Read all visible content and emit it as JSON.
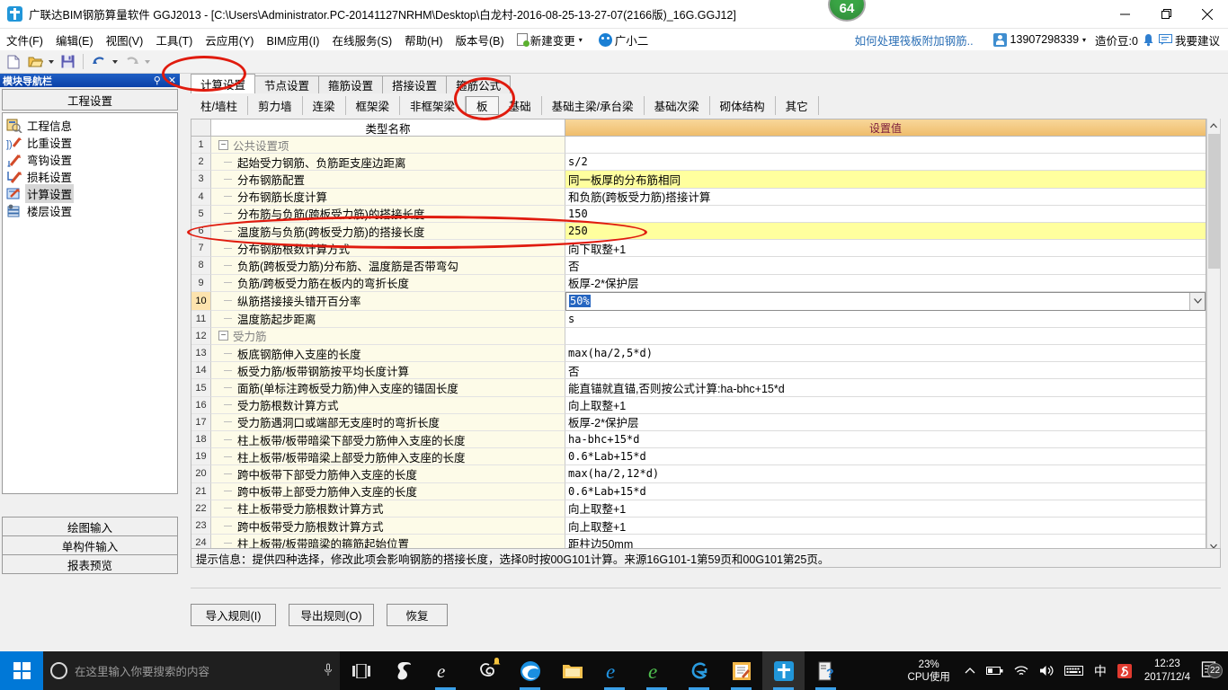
{
  "window": {
    "title": "广联达BIM钢筋算量软件 GGJ2013 - [C:\\Users\\Administrator.PC-20141127NRHM\\Desktop\\白龙村-2016-08-25-13-27-07(2166版)_16G.GGJ12]",
    "badge": "64",
    "minimize": "–",
    "maximize": "❐",
    "close": "✕"
  },
  "menu": {
    "items": [
      "文件(F)",
      "编辑(E)",
      "视图(V)",
      "工具(T)",
      "云应用(Y)",
      "BIM应用(I)",
      "在线服务(S)",
      "帮助(H)",
      "版本号(B)"
    ],
    "new_change": "新建变更",
    "assistant": "广小二",
    "help_link": "如何处理筏板附加钢筋..",
    "account": "13907298339",
    "coins": "造价豆:0",
    "feedback": "我要建议"
  },
  "left_panel": {
    "title": "模块导航栏",
    "pin": "⚲",
    "close": "✕",
    "group_title": "工程设置",
    "items": [
      {
        "label": "工程信息",
        "icon": "project-info-icon"
      },
      {
        "label": "比重设置",
        "icon": "weight-settings-icon"
      },
      {
        "label": "弯钩设置",
        "icon": "hook-settings-icon"
      },
      {
        "label": "损耗设置",
        "icon": "loss-settings-icon"
      },
      {
        "label": "计算设置",
        "icon": "calc-settings-icon"
      },
      {
        "label": "楼层设置",
        "icon": "floor-settings-icon"
      }
    ],
    "selected_index": 4,
    "bottom_buttons": [
      "绘图输入",
      "单构件输入",
      "报表预览"
    ]
  },
  "tabs_primary": {
    "items": [
      "计算设置",
      "节点设置",
      "箍筋设置",
      "搭接设置",
      "箍筋公式"
    ],
    "active_index": 0
  },
  "tabs_secondary": {
    "items": [
      "柱/墙柱",
      "剪力墙",
      "连梁",
      "框架梁",
      "非框架梁",
      "板",
      "基础",
      "基础主梁/承台梁",
      "基础次梁",
      "砌体结构",
      "其它"
    ],
    "active_index": 5
  },
  "grid": {
    "header": {
      "num": "",
      "name": "类型名称",
      "value": "设置值"
    },
    "rows": [
      {
        "n": "1",
        "kind": "group",
        "name": "公共设置项",
        "value": "",
        "vhl": false
      },
      {
        "n": "2",
        "kind": "item",
        "name": "起始受力钢筋、负筋距支座边距离",
        "value": "s/2",
        "vhl": false
      },
      {
        "n": "3",
        "kind": "item",
        "name": "分布钢筋配置",
        "value": "同一板厚的分布筋相同",
        "vhl": true,
        "cn": true
      },
      {
        "n": "4",
        "kind": "item",
        "name": "分布钢筋长度计算",
        "value": "和负筋(跨板受力筋)搭接计算",
        "vhl": false,
        "cn": true
      },
      {
        "n": "5",
        "kind": "item",
        "name": "分布筋与负筋(跨板受力筋)的搭接长度",
        "value": "150",
        "vhl": false
      },
      {
        "n": "6",
        "kind": "item",
        "name": "温度筋与负筋(跨板受力筋)的搭接长度",
        "value": "250",
        "vhl": true
      },
      {
        "n": "7",
        "kind": "item",
        "name": "分布钢筋根数计算方式",
        "value": "向下取整+1",
        "vhl": false,
        "cn": true
      },
      {
        "n": "8",
        "kind": "item",
        "name": "负筋(跨板受力筋)分布筋、温度筋是否带弯勾",
        "value": "否",
        "vhl": false,
        "cn": true
      },
      {
        "n": "9",
        "kind": "item",
        "name": "负筋/跨板受力筋在板内的弯折长度",
        "value": "板厚-2*保护层",
        "vhl": false,
        "cn": true
      },
      {
        "n": "10",
        "kind": "editor",
        "name": "纵筋搭接接头错开百分率",
        "value": "50%",
        "vhl": false
      },
      {
        "n": "11",
        "kind": "item",
        "name": "温度筋起步距离",
        "value": "s",
        "vhl": false
      },
      {
        "n": "12",
        "kind": "group",
        "name": "受力筋",
        "value": "",
        "vhl": false
      },
      {
        "n": "13",
        "kind": "item",
        "name": "板底钢筋伸入支座的长度",
        "value": "max(ha/2,5*d)",
        "vhl": false
      },
      {
        "n": "14",
        "kind": "item",
        "name": "板受力筋/板带钢筋按平均长度计算",
        "value": "否",
        "vhl": false,
        "cn": true
      },
      {
        "n": "15",
        "kind": "item",
        "name": "面筋(单标注跨板受力筋)伸入支座的锚固长度",
        "value": "能直锚就直锚,否则按公式计算:ha-bhc+15*d",
        "vhl": false,
        "cn": true
      },
      {
        "n": "16",
        "kind": "item",
        "name": "受力筋根数计算方式",
        "value": "向上取整+1",
        "vhl": false,
        "cn": true
      },
      {
        "n": "17",
        "kind": "item",
        "name": "受力筋遇洞口或端部无支座时的弯折长度",
        "value": "板厚-2*保护层",
        "vhl": false,
        "cn": true
      },
      {
        "n": "18",
        "kind": "item",
        "name": "柱上板带/板带暗梁下部受力筋伸入支座的长度",
        "value": "ha-bhc+15*d",
        "vhl": false
      },
      {
        "n": "19",
        "kind": "item",
        "name": "柱上板带/板带暗梁上部受力筋伸入支座的长度",
        "value": "0.6*Lab+15*d",
        "vhl": false
      },
      {
        "n": "20",
        "kind": "item",
        "name": "跨中板带下部受力筋伸入支座的长度",
        "value": "max(ha/2,12*d)",
        "vhl": false
      },
      {
        "n": "21",
        "kind": "item",
        "name": "跨中板带上部受力筋伸入支座的长度",
        "value": "0.6*Lab+15*d",
        "vhl": false
      },
      {
        "n": "22",
        "kind": "item",
        "name": "柱上板带受力筋根数计算方式",
        "value": "向上取整+1",
        "vhl": false,
        "cn": true
      },
      {
        "n": "23",
        "kind": "item",
        "name": "跨中板带受力筋根数计算方式",
        "value": "向上取整+1",
        "vhl": false,
        "cn": true
      },
      {
        "n": "24",
        "kind": "item",
        "name": "柱上板带/板带暗梁的箍筋起始位置",
        "value": "距柱边50mm",
        "vhl": false,
        "cn": true
      }
    ]
  },
  "hint": "提示信息：提供四种选择，修改此项会影响钢筋的搭接长度，选择0时按00G101计算。来源16G101-1第59页和00G101第25页。",
  "dialog_buttons": [
    "导入规则(I)",
    "导出规则(O)",
    "恢复"
  ],
  "taskbar": {
    "search_placeholder": "在这里输入你要搜索的内容",
    "cpu_percent": "23%",
    "cpu_label": "CPU使用",
    "time": "12:23",
    "date": "2017/12/4",
    "ime": "中",
    "notification_count": "22"
  },
  "colors": {
    "accent_blue": "#0a41a8",
    "header_orange": "#efbd6c",
    "highlight_yellow": "#ffff9e",
    "annotation_red": "#e01b0e",
    "taskbar_blue": "#0078d7"
  }
}
